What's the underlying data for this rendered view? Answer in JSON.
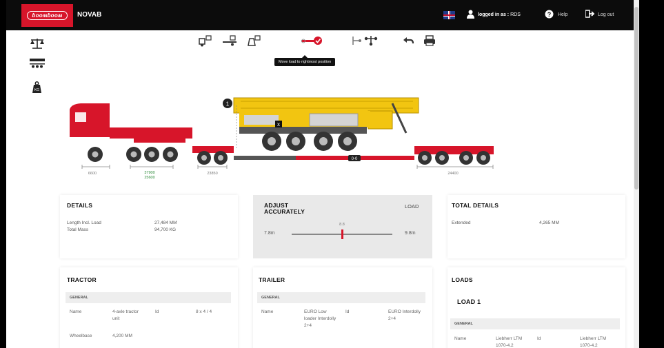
{
  "header": {
    "logo_text": "ɓooʍɓooʍ",
    "app_title": "NOVAB",
    "logged_in_label": "logged in as :",
    "logged_in_user": "RDS",
    "help_label": "Help",
    "logout_label": "Log out"
  },
  "toolbar": {
    "tooltip": "Move load to rightmost position"
  },
  "diagram": {
    "dim_tractor": "6600",
    "dim_axle_1": "37900",
    "dim_axle_2": "25600",
    "dim_gap": "23850",
    "dim_rear": "24400",
    "tag": "0-0",
    "marker": "1",
    "load_marker": "x"
  },
  "details": {
    "title": "DETAILS",
    "rows": [
      {
        "label": "Length Incl. Load",
        "value": "27,484 MM"
      },
      {
        "label": "Total Mass",
        "value": "94,700 KG"
      }
    ]
  },
  "adjust": {
    "title_line1": "ADJUST",
    "title_line2": "ACCURATELY",
    "mode": "LOAD",
    "min": "7.8m",
    "max": "9.8m",
    "current": "8.8",
    "slider_fraction": 0.5
  },
  "total": {
    "title": "TOTAL DETAILS",
    "rows": [
      {
        "label": "Extended",
        "value": "4,265 MM"
      }
    ]
  },
  "tractor": {
    "title": "TRACTOR",
    "section": "GENERAL",
    "name_label": "Name",
    "name_value": "4-axle tractor unit",
    "id_label": "Id",
    "id_value": "8 x 4 / 4",
    "wheelbase_label": "Wheelbase",
    "wheelbase_value": "4,200 MM"
  },
  "trailer": {
    "title": "TRAILER",
    "section": "GENERAL",
    "name_label": "Name",
    "name_value": "EURO Low loader Interdolly 2+4",
    "id_label": "Id",
    "id_value": "EURO Interdolly 2+4"
  },
  "loads": {
    "title": "LOADS",
    "load_title": "LOAD 1",
    "section": "GENERAL",
    "name_label": "Name",
    "name_value": "Liebherr LTM 1070-4.2",
    "id_label": "Id",
    "id_value": "Liebherr LTM 1070-4.2"
  },
  "colors": {
    "brand_red": "#d7152a",
    "crane_yellow": "#f2c511",
    "topbar": "#0c0c0c"
  }
}
